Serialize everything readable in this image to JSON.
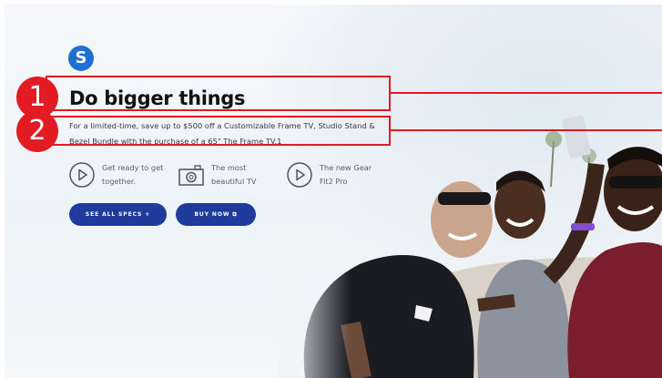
{
  "brand": {
    "logo_letter": "S"
  },
  "hero": {
    "headline": "Do bigger things",
    "subtext": "For a limited-time, save up to $500 off a Customizable Frame TV, Studio Stand & Bezel Bundle with the purchase of a 65\" The Frame TV.1"
  },
  "features": [
    {
      "icon": "play-circle-icon",
      "label": "Get ready to get\ntogether."
    },
    {
      "icon": "camera-icon",
      "label": "The most\nbeautiful TV"
    },
    {
      "icon": "play-circle-icon",
      "label": "The new Gear\nFit2 Pro"
    }
  ],
  "buttons": {
    "see_all_specs": "SEE ALL SPECS +",
    "buy_now": "BUY NOW ⧉"
  },
  "annotations": [
    {
      "number": "1",
      "target": "headline"
    },
    {
      "number": "2",
      "target": "subtext"
    }
  ],
  "colors": {
    "brand_blue": "#1f6fd1",
    "button_blue": "#1f3b9c",
    "annotation_red": "#e11b22"
  }
}
